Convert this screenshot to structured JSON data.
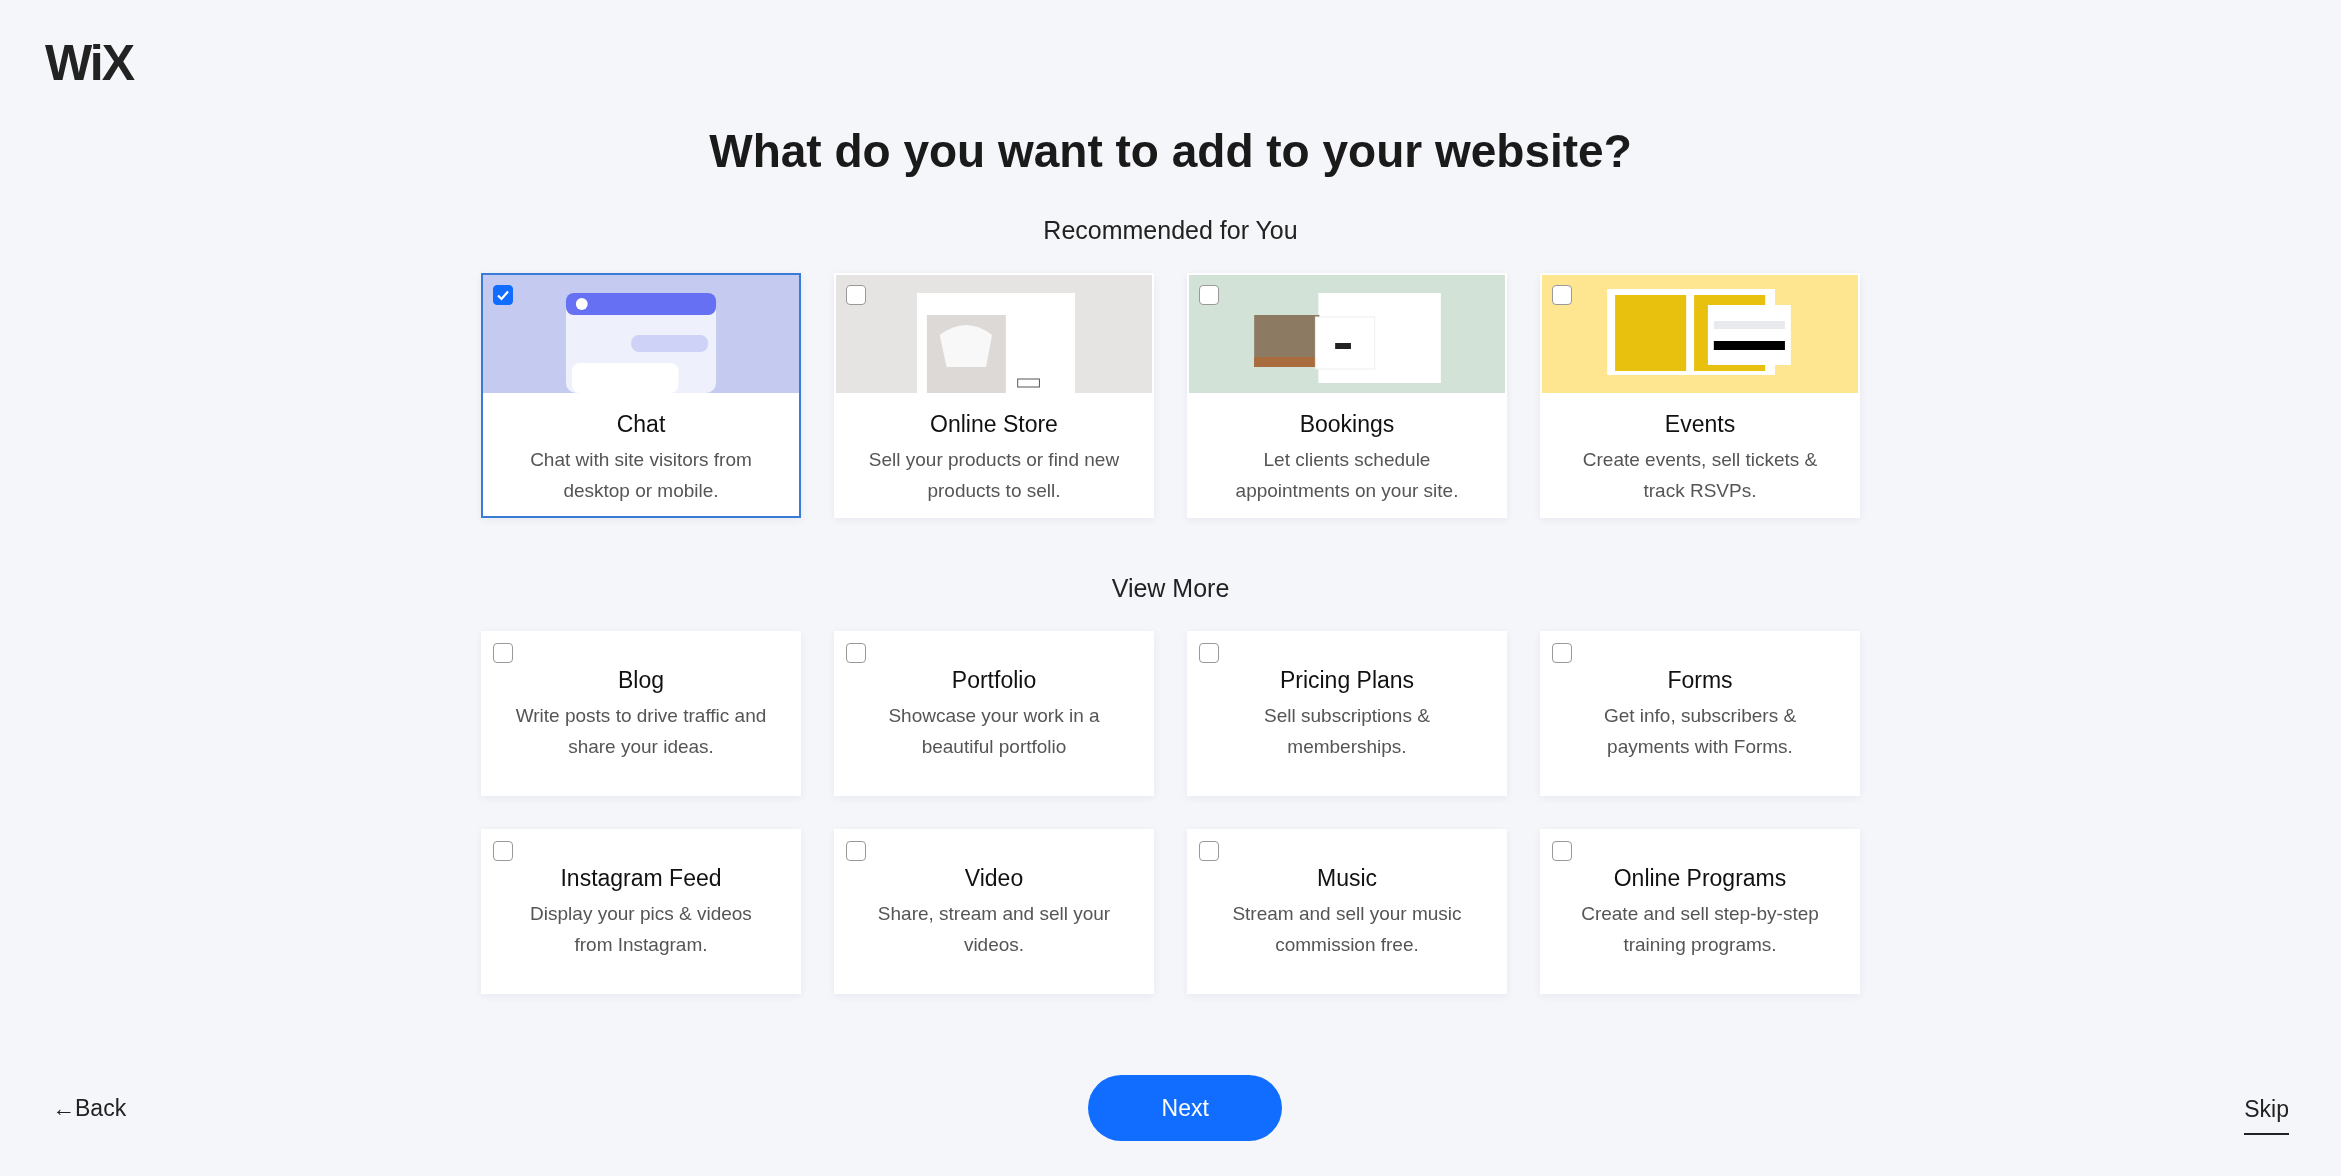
{
  "logo": "WiX",
  "title": "What do you want to add to your website?",
  "recommended": {
    "heading": "Recommended for You",
    "items": [
      {
        "kind": "picture",
        "title": "Chat",
        "description": "Chat with site visitors from desktop or mobile.",
        "selected": true
      },
      {
        "kind": "picture",
        "title": "Online Store",
        "description": "Sell your products or find new products to sell.",
        "selected": false
      },
      {
        "kind": "picture",
        "title": "Bookings",
        "description": "Let clients schedule appointments on your site.",
        "selected": false
      },
      {
        "kind": "picture",
        "title": "Events",
        "description": "Create events, sell tickets & track RSVPs.",
        "selected": false
      }
    ]
  },
  "more": {
    "heading": "View More",
    "items": [
      {
        "title": "Blog",
        "description": "Write posts to drive traffic and share your ideas.",
        "selected": false
      },
      {
        "title": "Portfolio",
        "description": "Showcase your work in a beautiful portfolio",
        "selected": false
      },
      {
        "title": "Pricing Plans",
        "description": "Sell subscriptions & memberships.",
        "selected": false
      },
      {
        "title": "Forms",
        "description": "Get info, subscribers & payments with Forms.",
        "selected": false
      },
      {
        "title": "Instagram Feed",
        "description": "Display your pics & videos from Instagram.",
        "selected": false
      },
      {
        "title": "Video",
        "description": "Share, stream and sell your videos.",
        "selected": false
      },
      {
        "title": "Music",
        "description": "Stream and sell your music commission free.",
        "selected": false
      },
      {
        "title": "Online Programs",
        "description": "Create and sell step-by-step training programs.",
        "selected": false
      }
    ]
  },
  "footer": {
    "back": "←Back",
    "next": "Next",
    "skip": "Skip"
  }
}
